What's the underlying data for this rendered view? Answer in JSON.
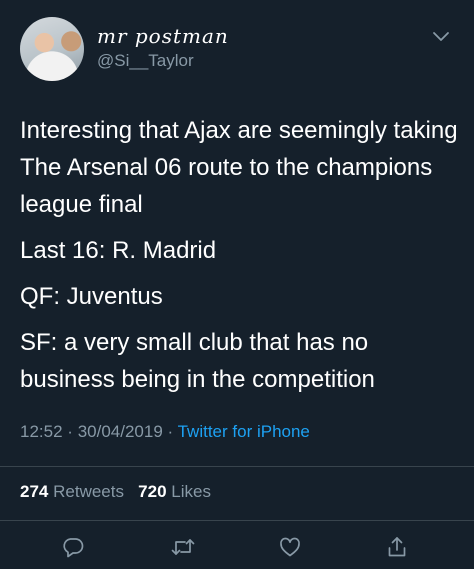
{
  "author": {
    "display_name": "mr postman",
    "handle": "@Si__Taylor"
  },
  "tweet": {
    "paragraphs": [
      "Interesting that Ajax are seemingly taking The Arsenal 06 route to the champions league final",
      "Last 16: R. Madrid",
      "QF: Juventus",
      "SF: a very small club that has no business being in the competition"
    ],
    "time": "12:52",
    "date": "30/04/2019",
    "separator": "·",
    "source": "Twitter for iPhone"
  },
  "stats": {
    "retweets_count": "274",
    "retweets_label": "Retweets",
    "likes_count": "720",
    "likes_label": "Likes"
  },
  "icons": {
    "menu": "chevron-down-icon",
    "reply": "reply-icon",
    "retweet": "retweet-icon",
    "like": "heart-icon",
    "share": "share-icon"
  },
  "colors": {
    "background": "#15202b",
    "text": "#ffffff",
    "secondary_text": "#8899a6",
    "link": "#1da1f2",
    "divider": "#38444d"
  }
}
